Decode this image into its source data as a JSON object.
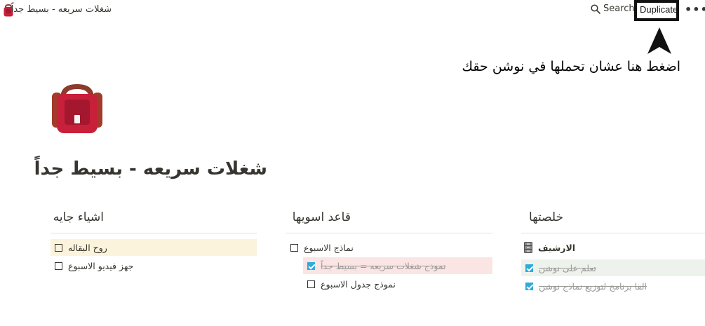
{
  "topbar": {
    "page_title": "شغلات سريعه - بسيط جداً",
    "search_label": "Search",
    "duplicate_label": "Duplicate",
    "more_label": "•••"
  },
  "annotation": {
    "text": "اضغط هنا عشان تحملها في نوشن حقك"
  },
  "page": {
    "title": "شغلات سريعه - بسيط جداً",
    "icon": "backpack-icon"
  },
  "columns": [
    {
      "heading": "اشياء جايه",
      "items": [
        {
          "label": "روح البقاله",
          "checked": false,
          "highlight": "yellow"
        },
        {
          "label": "جهز فيديو الاسبوع",
          "checked": false,
          "highlight": ""
        }
      ]
    },
    {
      "heading": "قاعد اسويها",
      "items": [
        {
          "label": "نماذج الاسبوع",
          "checked": false,
          "highlight": ""
        },
        {
          "label": "نموذج شغلات سريعه = بسيط جداً",
          "checked": true,
          "highlight": "red",
          "indent": true
        },
        {
          "label": "نموذج جدول الاسبوع",
          "checked": false,
          "highlight": "",
          "indent": true
        }
      ]
    },
    {
      "heading": "خلصتها",
      "items": [
        {
          "label": "الارشيف",
          "type": "page",
          "icon": "filing-cabinet-icon"
        },
        {
          "label": "تعلم على نوشن",
          "checked": true,
          "highlight": "green"
        },
        {
          "label": "القا برنامج لتوزيع نماذج نوشن",
          "checked": true,
          "highlight": ""
        }
      ]
    }
  ],
  "colors": {
    "text": "#37352f",
    "checkbox_checked": "#2eaadc",
    "yellow_highlight": "#fbf3db",
    "red_highlight": "#fbe4e4",
    "green_highlight": "#edf3ec"
  }
}
